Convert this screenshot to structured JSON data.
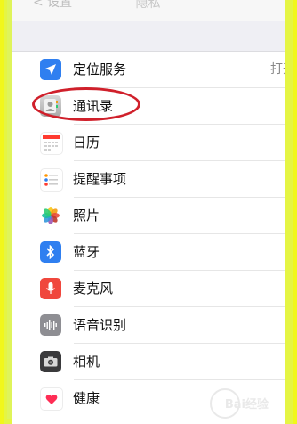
{
  "nav": {
    "title": "隐私",
    "back": "< 设置"
  },
  "items": [
    {
      "label": "定位服务",
      "detail": "打开",
      "icon": "location-arrow-icon",
      "color": "#2f7ff0"
    },
    {
      "label": "通讯录",
      "detail": "",
      "icon": "contacts-icon",
      "color": "#9a9a9a"
    },
    {
      "label": "日历",
      "detail": "",
      "icon": "calendar-icon",
      "color": "#ff3b30"
    },
    {
      "label": "提醒事项",
      "detail": "",
      "icon": "reminders-icon",
      "color": "#ffffff"
    },
    {
      "label": "照片",
      "detail": "",
      "icon": "photos-icon",
      "color": "#ffffff"
    },
    {
      "label": "蓝牙",
      "detail": "",
      "icon": "bluetooth-icon",
      "color": "#2f7ff0"
    },
    {
      "label": "麦克风",
      "detail": "",
      "icon": "microphone-icon",
      "color": "#f0473d"
    },
    {
      "label": "语音识别",
      "detail": "",
      "icon": "speech-recognition-icon",
      "color": "#8e8e93"
    },
    {
      "label": "相机",
      "detail": "",
      "icon": "camera-icon",
      "color": "#3a3a3c"
    },
    {
      "label": "健康",
      "detail": "",
      "icon": "health-icon",
      "color": "#ffffff"
    }
  ],
  "watermark": "Bai经验"
}
